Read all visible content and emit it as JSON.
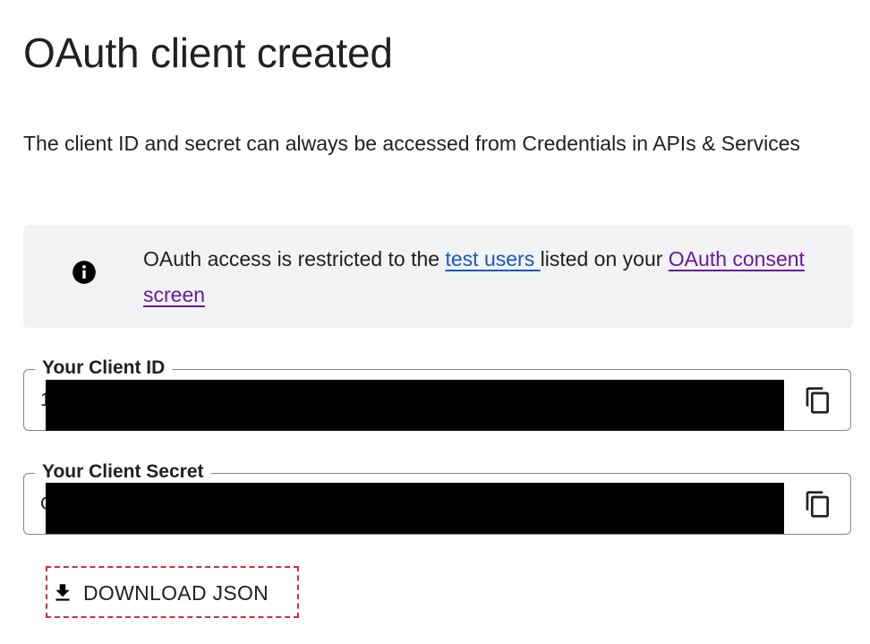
{
  "dialog": {
    "title": "OAuth client created",
    "description": "The client ID and secret can always be accessed from Credentials in APIs & Services"
  },
  "notice": {
    "icon": "info-icon",
    "text_before": "OAuth access is restricted to the ",
    "link_test_users": "test users ",
    "text_middle": "listed on your ",
    "link_consent_screen": "OAuth consent screen",
    "link_colors": {
      "visited": "#6a1b9a",
      "unvisited": "#1a56c4"
    }
  },
  "client_id": {
    "label": "Your Client ID",
    "value_visible": "1",
    "copy_icon": "copy-icon"
  },
  "client_secret": {
    "label": "Your Client Secret",
    "value_visible": "G",
    "copy_icon": "copy-icon"
  },
  "download": {
    "label": "DOWNLOAD JSON",
    "icon": "download-icon",
    "highlight_color": "#d32f2f"
  }
}
